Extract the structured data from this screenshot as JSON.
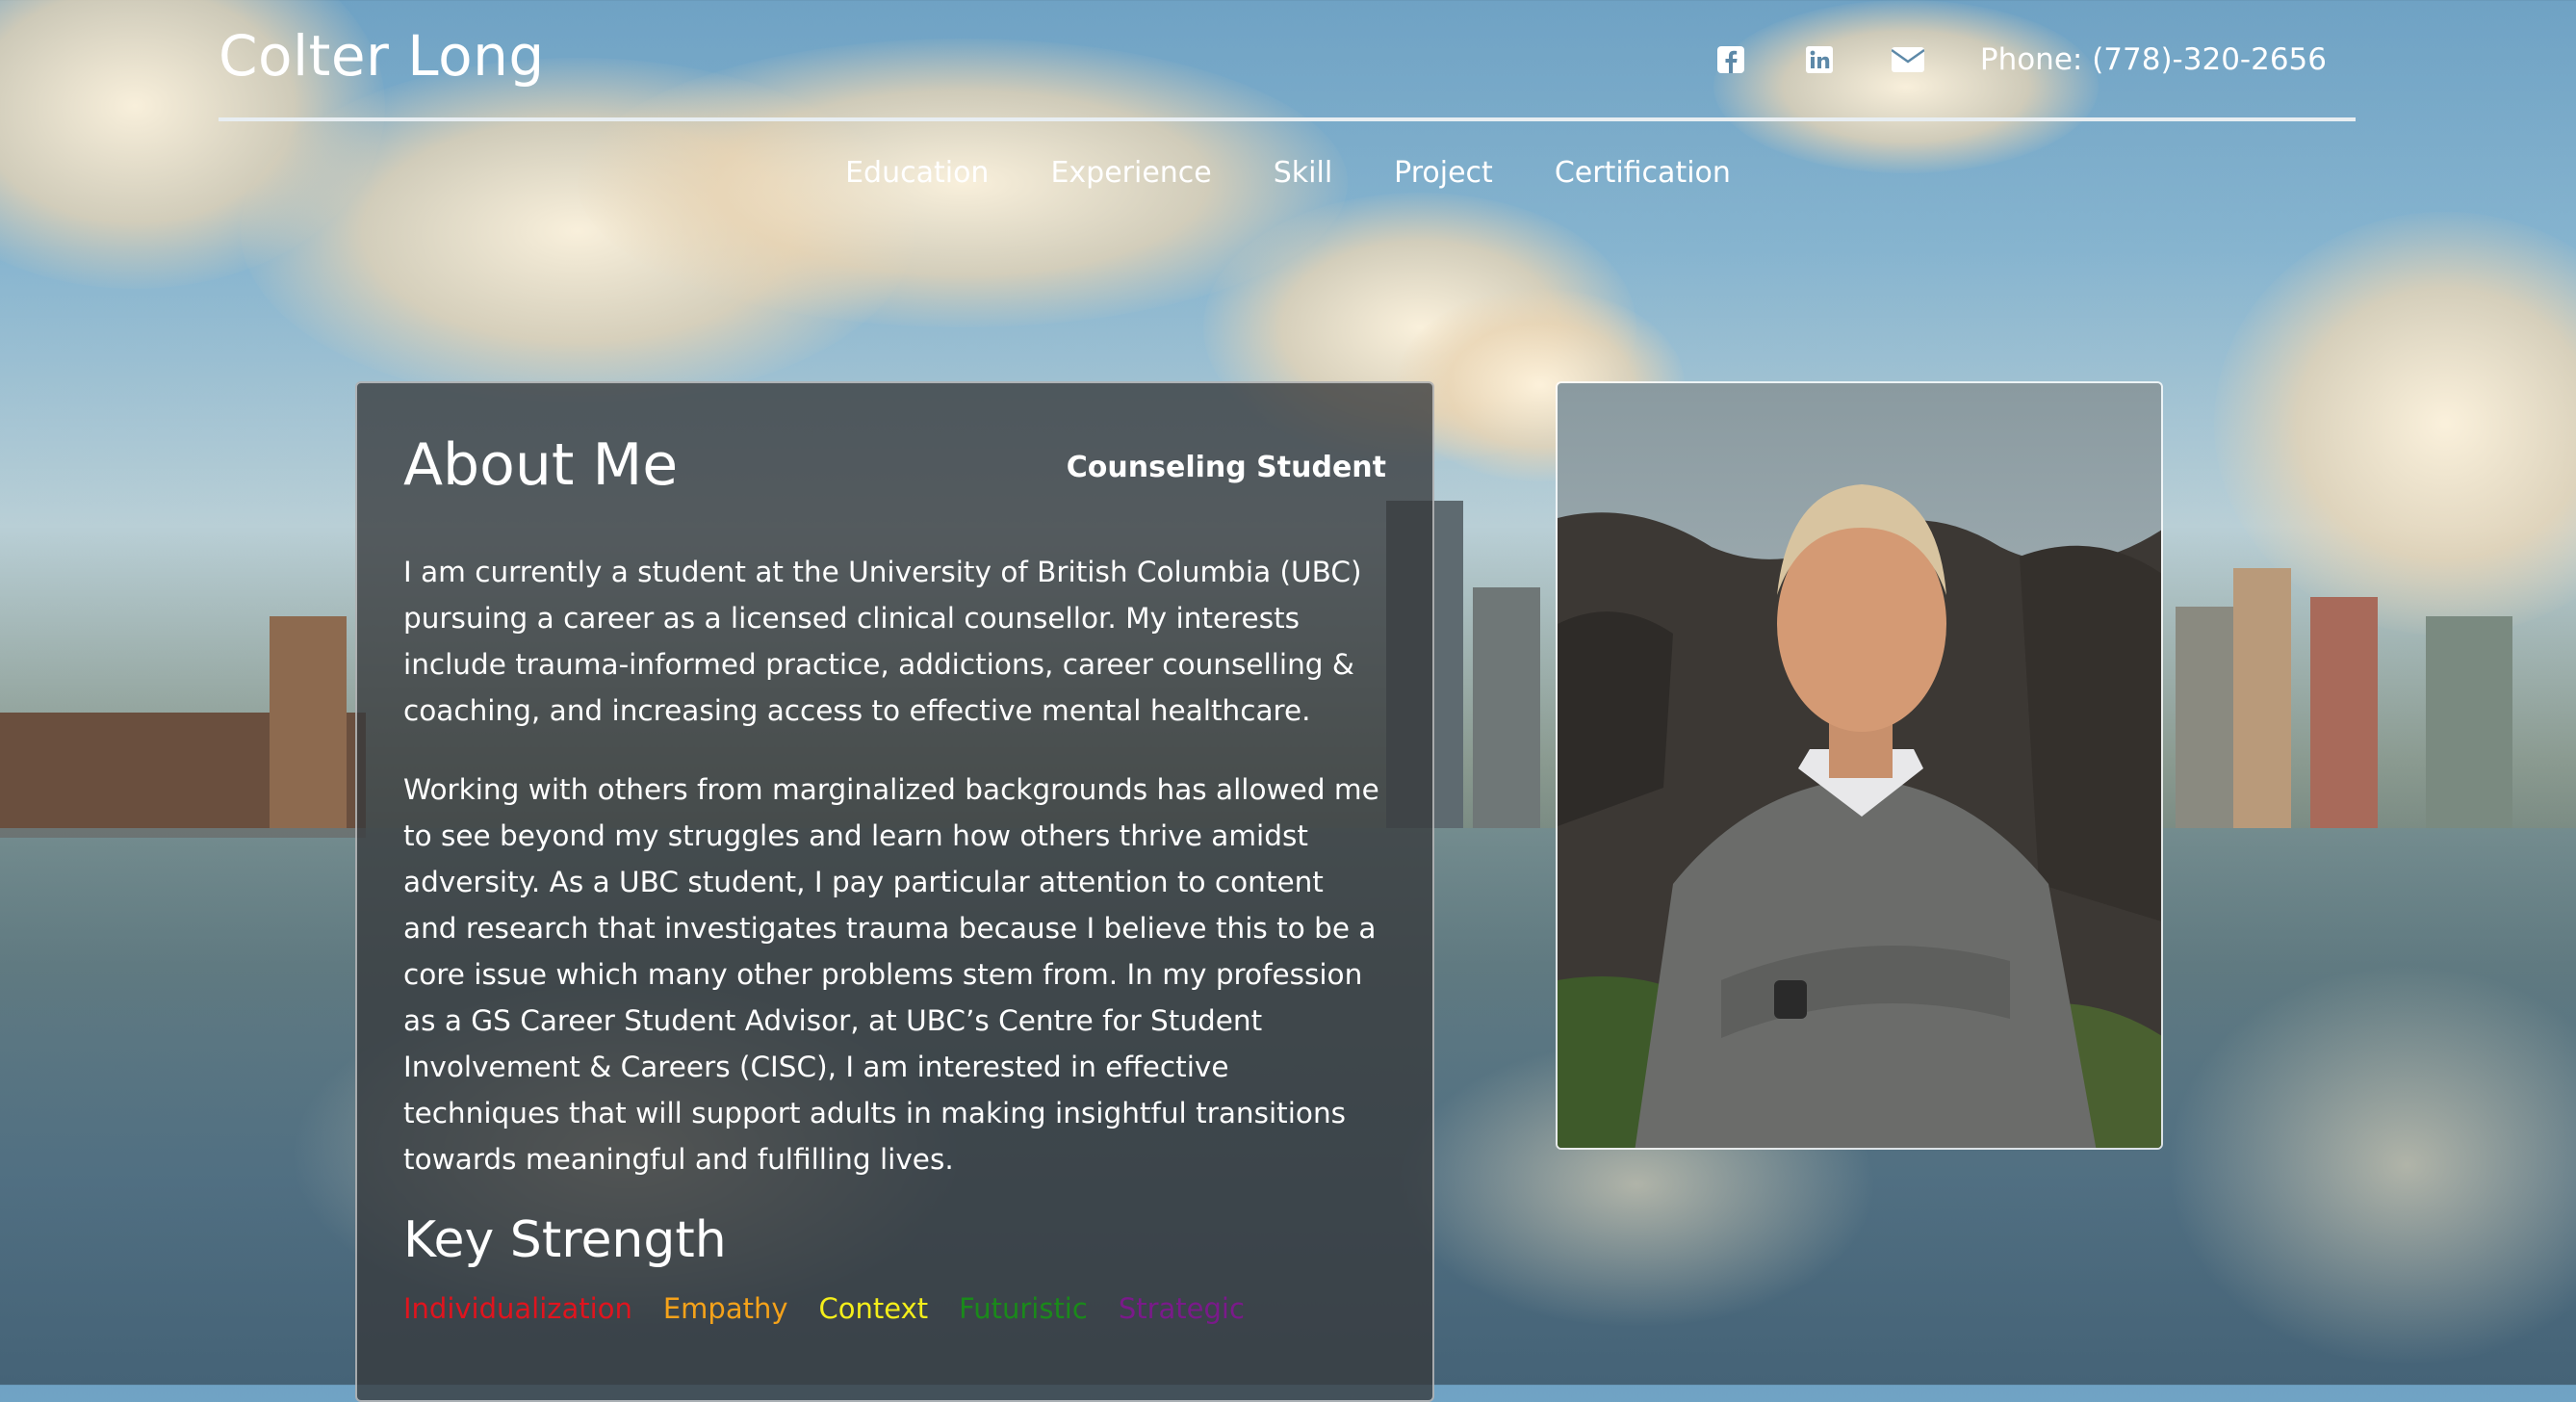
{
  "header": {
    "name": "Colter Long",
    "phone": "Phone: (778)-320-2656",
    "icons": [
      "facebook-icon",
      "linkedin-icon",
      "email-icon"
    ]
  },
  "nav": {
    "items": [
      "Education",
      "Experience",
      "Skill",
      "Project",
      "Certification"
    ]
  },
  "about": {
    "title": "About Me",
    "role": "Counseling Student",
    "paragraph1": "I am currently a student at the University of British Columbia (UBC) pursuing a career as a licensed clinical counsellor. My interests include trauma-informed practice, addictions, career counselling & coaching, and increasing access to effective mental healthcare.",
    "paragraph2": "Working with others from marginalized backgrounds has allowed me to see beyond my struggles and learn how others thrive amidst adversity. As a UBC student, I pay particular attention to content and research that investigates trauma because I believe this to be a core issue which many other problems stem from. In my profession as a GS Career Student Advisor, at UBC’s Centre for Student Involvement & Careers (CISC), I am interested in effective techniques that will support adults in making insightful transitions towards meaningful and fulfilling lives."
  },
  "key_strength": {
    "title": "Key Strength",
    "items": [
      {
        "label": "Individualization",
        "color": "#e0141e"
      },
      {
        "label": "Empathy",
        "color": "#f5a21a"
      },
      {
        "label": "Context",
        "color": "#f4ee1a"
      },
      {
        "label": "Futuristic",
        "color": "#1a8a1a"
      },
      {
        "label": "Strategic",
        "color": "#7a1a8a"
      }
    ]
  },
  "colors": {
    "panel": "#37393c",
    "text": "#ffffff"
  }
}
